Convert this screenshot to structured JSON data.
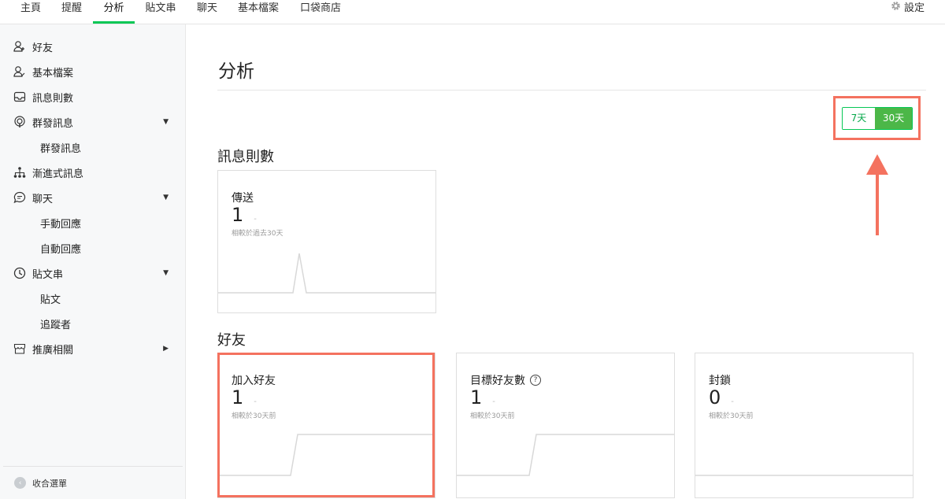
{
  "topnav": {
    "tabs": [
      {
        "label": "主頁"
      },
      {
        "label": "提醒"
      },
      {
        "label": "分析"
      },
      {
        "label": "貼文串"
      },
      {
        "label": "聊天"
      },
      {
        "label": "基本檔案"
      },
      {
        "label": "口袋商店"
      }
    ],
    "active_tab": "分析",
    "settings_label": "設定",
    "settings_icon": "gear-icon"
  },
  "sidebar": {
    "items": [
      {
        "label": "好友",
        "icon": "friend-icon"
      },
      {
        "label": "基本檔案",
        "icon": "profile-icon"
      },
      {
        "label": "訊息則數",
        "icon": "inbox-icon"
      },
      {
        "label": "群發訊息",
        "icon": "broadcast-icon",
        "expanded": true
      },
      {
        "label": "群發訊息",
        "sub": true
      },
      {
        "label": "漸進式訊息",
        "icon": "hierarchy-icon"
      },
      {
        "label": "聊天",
        "icon": "chat-bubble-icon",
        "expanded": true
      },
      {
        "label": "手動回應",
        "sub": true
      },
      {
        "label": "自動回應",
        "sub": true
      },
      {
        "label": "貼文串",
        "icon": "clock-icon",
        "expanded": true
      },
      {
        "label": "貼文",
        "sub": true
      },
      {
        "label": "追蹤者",
        "sub": true
      },
      {
        "label": "推廣相關",
        "icon": "store-icon",
        "expanded": false
      }
    ],
    "footer_label": "收合選單"
  },
  "main": {
    "title": "分析",
    "range": {
      "options": [
        "7天",
        "30天"
      ],
      "selected": "30天"
    },
    "sections": {
      "messages": {
        "title": "訊息則數",
        "cards": [
          {
            "title": "傳送",
            "value": "1",
            "change": "-",
            "compare": "相較於過去30天"
          }
        ]
      },
      "friends": {
        "title": "好友",
        "cards": [
          {
            "title": "加入好友",
            "value": "1",
            "change": "-",
            "compare": "相較於30天前"
          },
          {
            "title": "目標好友數",
            "value": "1",
            "change": "-",
            "compare": "相較於30天前",
            "help_icon": "question-circle-icon"
          },
          {
            "title": "封鎖",
            "value": "0",
            "change": "-",
            "compare": "相較於30天前"
          }
        ]
      }
    }
  },
  "colors": {
    "accent_green": "#06c755",
    "toggle_selected": "#4cb748",
    "annotation": "#f4725f"
  }
}
